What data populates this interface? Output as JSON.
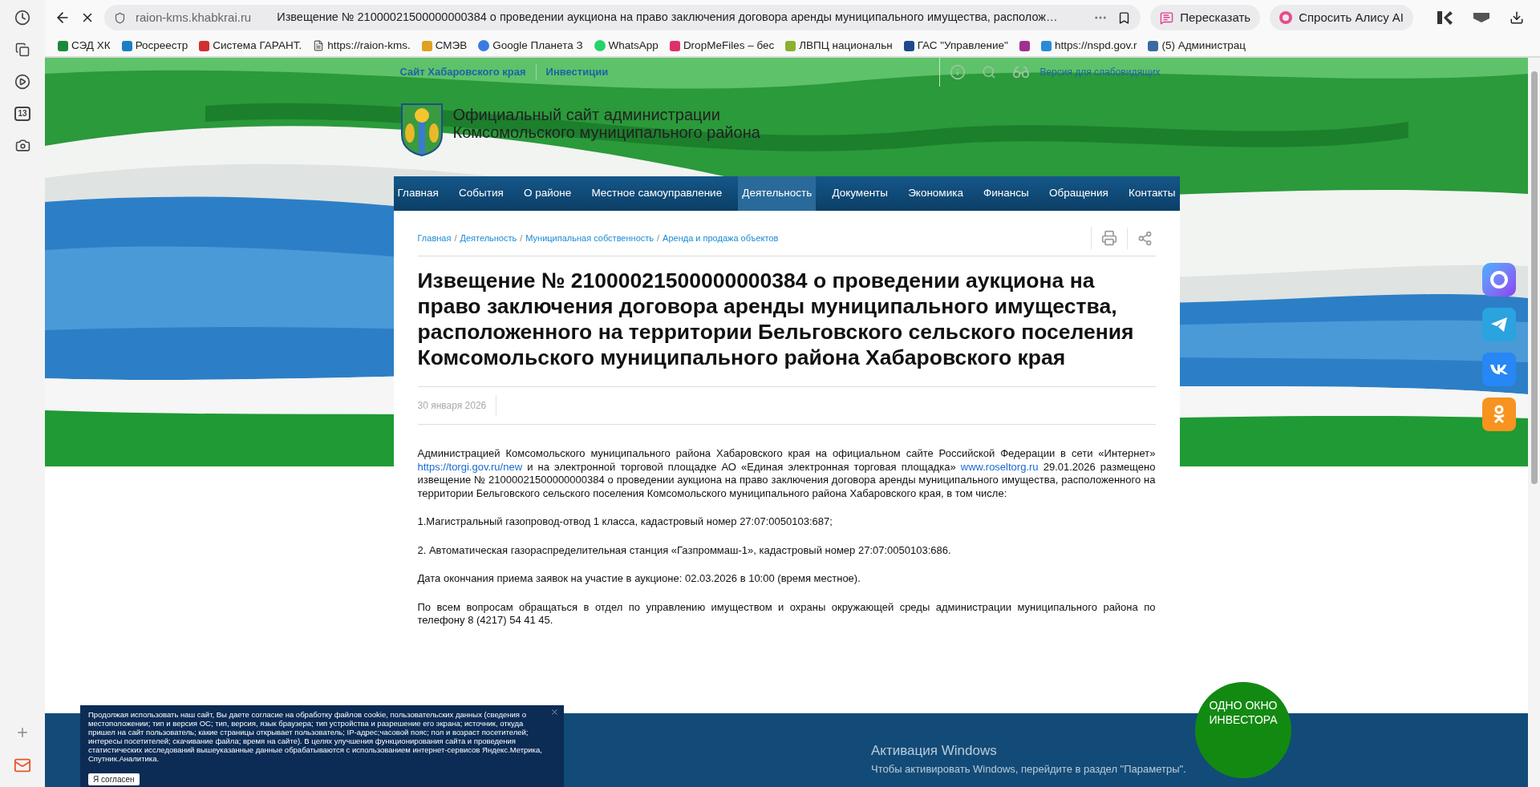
{
  "browser": {
    "sidebar_badge": "13",
    "url": "raion-kms.khabkrai.ru",
    "page_title": "Извещение № 21000021500000000384 о проведении аукциона на право заключения договора аренды муниципального имущества, располож…",
    "actions": [
      {
        "label": "Пересказать",
        "kind": "retell"
      },
      {
        "label": "Спросить Алису AI",
        "kind": "alice"
      }
    ],
    "bookmarks": [
      {
        "label": "СЭД ХК",
        "kind": "sed"
      },
      {
        "label": "Росреестр",
        "kind": "rosreestr"
      },
      {
        "label": "Система ГАРАНТ.",
        "kind": "garant"
      },
      {
        "label": "https://raion-kms.",
        "kind": "page"
      },
      {
        "label": "СМЭВ",
        "kind": "smev"
      },
      {
        "label": "Google Планета З",
        "kind": "earth"
      },
      {
        "label": "WhatsApp",
        "kind": "whatsapp"
      },
      {
        "label": "DropMeFiles – бес",
        "kind": "dropme"
      },
      {
        "label": "ЛВПЦ национальн",
        "kind": "lvpc"
      },
      {
        "label": "ГАС \"Управление\"",
        "kind": "gas"
      },
      {
        "kind": "archive"
      },
      {
        "label": "https://nspd.gov.r",
        "kind": "nspd"
      },
      {
        "label": "(5) Администрац",
        "kind": "admin"
      }
    ]
  },
  "site": {
    "top_links": [
      "Сайт Хабаровского края",
      "Инвестиции"
    ],
    "accessibility": "Версия для слабовидящих",
    "title_lines": [
      "Официальный сайт администрации",
      "Комсомольского муниципального района"
    ],
    "nav": [
      {
        "label": "Главная",
        "selected": false
      },
      {
        "label": "События",
        "selected": false
      },
      {
        "label": "О районе",
        "selected": false
      },
      {
        "label": "Местное самоуправление",
        "selected": false
      },
      {
        "label": "Деятельность",
        "selected": true
      },
      {
        "label": "Документы",
        "selected": false
      },
      {
        "label": "Экономика",
        "selected": false
      },
      {
        "label": "Финансы",
        "selected": false
      },
      {
        "label": "Обращения",
        "selected": false
      },
      {
        "label": "Контакты",
        "selected": false
      }
    ],
    "breadcrumbs": [
      "Главная",
      "Деятельность",
      "Муниципальная собственность",
      "Аренда и продажа объектов"
    ],
    "breadcrumb_separators": [
      "/",
      "/",
      "/"
    ],
    "article": {
      "title": "Извещение № 21000021500000000384 о проведении аукциона на право заключения договора аренды муниципального имущества, расположенного на территории Бельговского сельского поселения Комсомольского муниципального района Хабаровского края",
      "date": "30 января 2026",
      "intro": [
        {
          "kind": "text",
          "text": "Администрацией Комсомольского муниципального района Хабаровского края на официальном сайте Российской Федерации в сети «Интернет» "
        },
        {
          "kind": "link",
          "text": "https://torgi.gov.ru/new"
        },
        {
          "kind": "text",
          "text": " и на электронной торговой площадке АО «Единая электронная торговая площадка» "
        },
        {
          "kind": "link",
          "text": "www.roseltorg.ru"
        },
        {
          "kind": "text",
          "text": "  29.01.2026 размещено извещение № 21000021500000000384 о проведении аукциона на право заключения договора аренды муниципального имущества, расположенного на территории Бельговского сельского поселения Комсомольского муниципального района Хабаровского края, в том числе:"
        }
      ],
      "paragraphs": [
        "1.Магистральный газопровод-отвод 1 класса, кадастровый номер 27:07:0050103:687;",
        "2. Автоматическая газораспределительная станция «Газпроммаш-1», кадастровый номер 27:07:0050103:686.",
        "Дата окончания приема заявок на участие в аукционе: 02.03.2026 в 10:00 (время местное).",
        "По всем вопросам обращаться в отдел по управлению имуществом и охраны окружающей среды администрации муниципального района по телефону 8 (4217) 54 41 45."
      ]
    }
  },
  "cookie": {
    "text": "Продолжая использовать наш сайт, Вы даете согласие на обработку файлов cookie, пользовательских данных (сведения о местоположении; тип и версия ОС; тип, версия, язык браузера; тип устройства и разрешение его экрана; источник, откуда пришел на сайт пользователь; какие страницы открывает пользователь; IP-адрес;часовой пояс; пол и возраст посетителей; интересы посетителей; скачивание файла; время на сайте). В целях улучшения функционирования сайта и проведения статистических исследований вышеуказанные данные обрабатываются с использованием интернет-сервисов Яндекс.Метрика, Спутник.Аналитика.",
    "button": "Я согласен"
  },
  "investor_badge": [
    "ОДНО ОКНО",
    "ИНВЕСТОРА"
  ],
  "windows_activation": {
    "title": "Активация Windows",
    "text": "Чтобы активировать Windows, перейдите в раздел \"Параметры\"."
  }
}
